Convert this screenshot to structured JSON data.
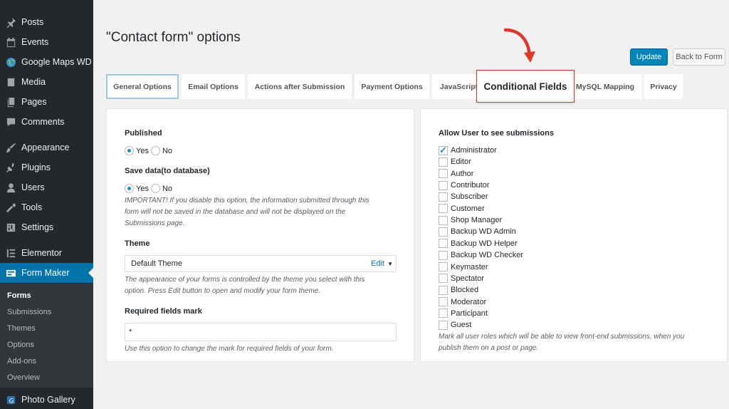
{
  "sidebar": {
    "items": [
      {
        "label": "Posts",
        "icon": "pin-icon"
      },
      {
        "label": "Events",
        "icon": "calendar-icon"
      },
      {
        "label": "Google Maps WD",
        "icon": "globe-icon"
      },
      {
        "label": "Media",
        "icon": "media-icon"
      },
      {
        "label": "Pages",
        "icon": "pages-icon"
      },
      {
        "label": "Comments",
        "icon": "comment-icon"
      },
      {
        "label": "Appearance",
        "icon": "brush-icon"
      },
      {
        "label": "Plugins",
        "icon": "plugin-icon"
      },
      {
        "label": "Users",
        "icon": "user-icon"
      },
      {
        "label": "Tools",
        "icon": "wrench-icon"
      },
      {
        "label": "Settings",
        "icon": "settings-icon"
      },
      {
        "label": "Elementor",
        "icon": "elementor-icon"
      },
      {
        "label": "Form Maker",
        "icon": "form-icon"
      },
      {
        "label": "Photo Gallery",
        "icon": "gallery-icon"
      }
    ],
    "submenu": [
      "Forms",
      "Submissions",
      "Themes",
      "Options",
      "Add-ons",
      "Overview"
    ]
  },
  "header": {
    "title": "\"Contact form\" options",
    "update_label": "Update",
    "back_label": "Back to Form"
  },
  "tabs": [
    "General Options",
    "Email Options",
    "Actions after Submission",
    "Payment Options",
    "JavaScript",
    "Conditional Fields",
    "MySQL Mapping",
    "Privacy"
  ],
  "general": {
    "published_label": "Published",
    "yes": "Yes",
    "no": "No",
    "save_label": "Save data(to database)",
    "save_desc_1": "IMPORTANT! If you disable this option, the information submitted through this",
    "save_desc_2": "form will not be saved in the database and will not be displayed on the",
    "save_desc_3": "Submissions page.",
    "theme_label": "Theme",
    "theme_value": "Default Theme",
    "theme_edit": "Edit",
    "theme_desc_1": "The appearance of your forms is controlled by the theme you select with this",
    "theme_desc_2": "option. Press Edit button to open and modify your form theme.",
    "required_label": "Required fields mark",
    "required_value": "*",
    "required_desc": "Use this option to change the mark for required fields of your form."
  },
  "submissions": {
    "label": "Allow User to see submissions",
    "roles": [
      {
        "name": "Administrator",
        "checked": true
      },
      {
        "name": "Editor",
        "checked": false
      },
      {
        "name": "Author",
        "checked": false
      },
      {
        "name": "Contributor",
        "checked": false
      },
      {
        "name": "Subscriber",
        "checked": false
      },
      {
        "name": "Customer",
        "checked": false
      },
      {
        "name": "Shop Manager",
        "checked": false
      },
      {
        "name": "Backup WD Admin",
        "checked": false
      },
      {
        "name": "Backup WD Helper",
        "checked": false
      },
      {
        "name": "Backup WD Checker",
        "checked": false
      },
      {
        "name": "Keymaster",
        "checked": false
      },
      {
        "name": "Spectator",
        "checked": false
      },
      {
        "name": "Blocked",
        "checked": false
      },
      {
        "name": "Moderator",
        "checked": false
      },
      {
        "name": "Participant",
        "checked": false
      },
      {
        "name": "Guest",
        "checked": false
      }
    ],
    "desc_1": "Mark all user roles which will be able to view front-end submissions, when you",
    "desc_2": "publish them on a post or page."
  },
  "colors": {
    "accent": "#0073aa",
    "highlight": "#e0362a",
    "sidebar": "#23282d"
  }
}
